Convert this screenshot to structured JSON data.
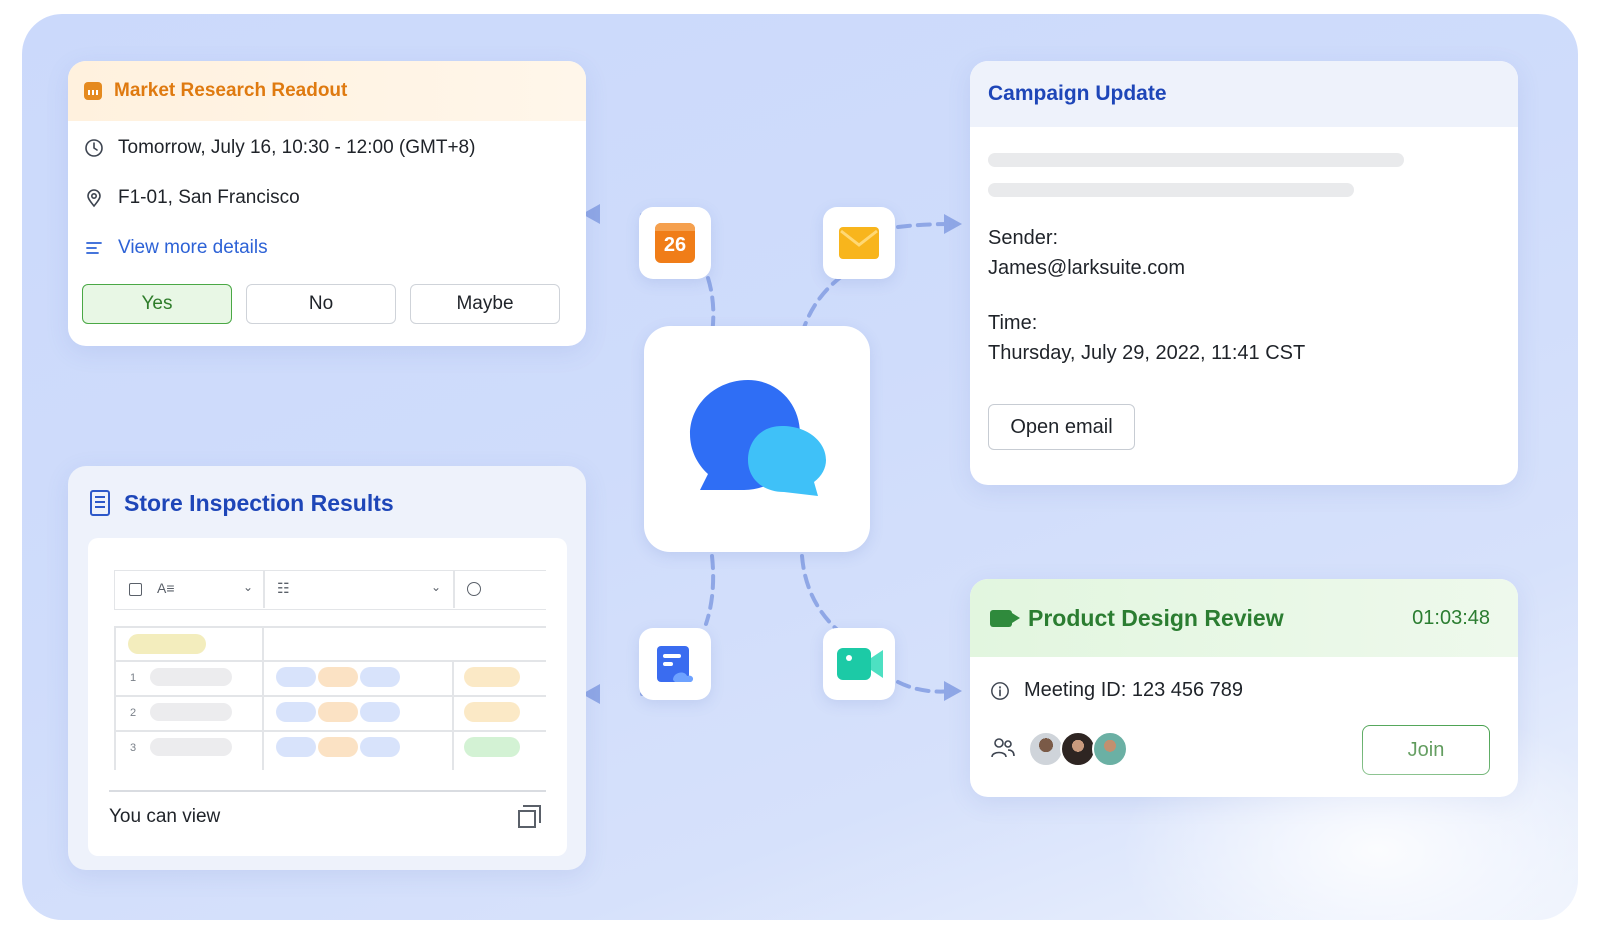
{
  "market": {
    "title": "Market Research Readout",
    "time": "Tomorrow, July 16, 10:30 - 12:00 (GMT+8)",
    "location": "F1-01, San Francisco",
    "details_link": "View more details",
    "yes_label": "Yes",
    "no_label": "No",
    "maybe_label": "Maybe"
  },
  "campaign": {
    "title": "Campaign Update",
    "sender_label": "Sender:",
    "sender_value": "James@larksuite.com",
    "time_label": "Time:",
    "time_value": "Thursday, July 29, 2022, 11:41 CST",
    "open_label": "Open email"
  },
  "store": {
    "title": "Store Inspection Results",
    "rows": [
      "1",
      "2",
      "3"
    ],
    "footer": "You can view"
  },
  "review": {
    "title": "Product Design Review",
    "timer": "01:03:48",
    "meeting_id": "Meeting ID: 123 456 789",
    "join_label": "Join"
  },
  "apps": {
    "calendar_day": "26"
  },
  "colors": {
    "accent_orange": "#df7a10",
    "accent_blue": "#1e46b8",
    "accent_green": "#2b7d31",
    "link_blue": "#2d62d6"
  }
}
